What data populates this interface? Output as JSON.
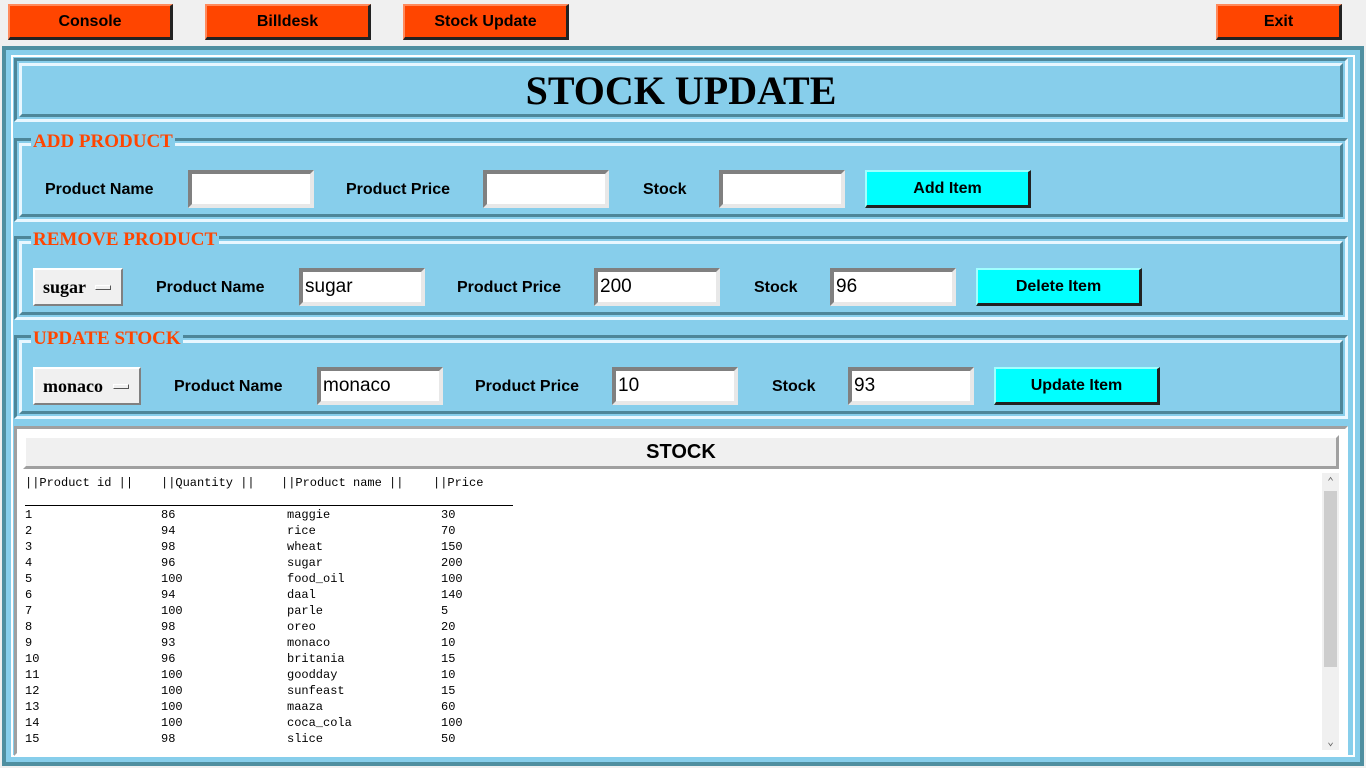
{
  "nav": {
    "console": "Console",
    "billdesk": "Billdesk",
    "stock_update": "Stock Update",
    "exit": "Exit"
  },
  "header": {
    "title": "STOCK UPDATE"
  },
  "add_product": {
    "legend": "ADD PRODUCT",
    "name_label": "Product Name",
    "price_label": "Product Price",
    "stock_label": "Stock",
    "name_value": "",
    "price_value": "",
    "stock_value": "",
    "button": "Add Item"
  },
  "remove_product": {
    "legend": "REMOVE PRODUCT",
    "selected": "sugar",
    "name_label": "Product Name",
    "price_label": "Product Price",
    "stock_label": "Stock",
    "name_value": "sugar",
    "price_value": "200",
    "stock_value": "96",
    "button": "Delete Item"
  },
  "update_stock": {
    "legend": "UPDATE STOCK",
    "selected": "monaco",
    "name_label": "Product Name",
    "price_label": "Product Price",
    "stock_label": "Stock",
    "name_value": "monaco",
    "price_value": "10",
    "stock_value": "93",
    "button": "Update Item"
  },
  "stock": {
    "title": "STOCK",
    "columns": [
      "||Product id ||",
      "||Quantity ||",
      "||Product name ||",
      "||Price"
    ],
    "rows": [
      [
        "1",
        "86",
        "maggie",
        "30"
      ],
      [
        "2",
        "94",
        "rice",
        "70"
      ],
      [
        "3",
        "98",
        "wheat",
        "150"
      ],
      [
        "4",
        "96",
        "sugar",
        "200"
      ],
      [
        "5",
        "100",
        "food_oil",
        "100"
      ],
      [
        "6",
        "94",
        "daal",
        "140"
      ],
      [
        "7",
        "100",
        "parle",
        "5"
      ],
      [
        "8",
        "98",
        "oreo",
        "20"
      ],
      [
        "9",
        "93",
        "monaco",
        "10"
      ],
      [
        "10",
        "96",
        "britania",
        "15"
      ],
      [
        "11",
        "100",
        "goodday",
        "10"
      ],
      [
        "12",
        "100",
        "sunfeast",
        "15"
      ],
      [
        "13",
        "100",
        "maaza",
        "60"
      ],
      [
        "14",
        "100",
        "coca_cola",
        "100"
      ],
      [
        "15",
        "98",
        "slice",
        "50"
      ]
    ]
  },
  "colors": {
    "nav_button": "#ff4500",
    "panel": "#87ceeb",
    "action_button": "#00ffff",
    "legend_text": "#ff4500"
  }
}
